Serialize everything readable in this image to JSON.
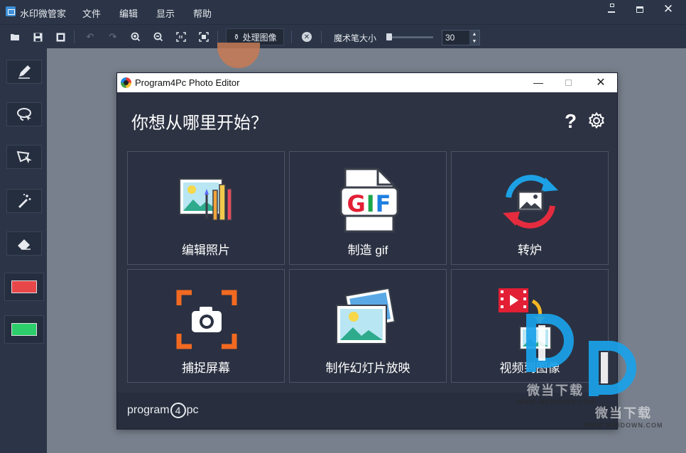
{
  "app": {
    "title": "水印微管家",
    "menu": [
      "文件",
      "编辑",
      "显示",
      "帮助"
    ]
  },
  "window_controls": {
    "minimize": "—",
    "maximize": "□",
    "close": "✕"
  },
  "toolbar": {
    "process_label": "处理图像",
    "brush_size_label": "魔术笔大小",
    "brush_size_value": "30",
    "brush_size_slider_fraction": 0.06
  },
  "sidebar": {
    "tools": [
      "pencil-icon",
      "lasso-icon",
      "polygon-lasso-icon",
      "magic-wand-icon",
      "eraser-icon"
    ],
    "swatch_colors": [
      "#e8474a",
      "#2dcf6c"
    ]
  },
  "dialog": {
    "title": "Program4Pc Photo Editor",
    "heading": "你想从哪里开始？",
    "help_label": "?",
    "cards": [
      {
        "label": "编辑照片"
      },
      {
        "label": "制造 gif"
      },
      {
        "label": "转炉"
      },
      {
        "label": "捕捉屏幕"
      },
      {
        "label": "制作幻灯片放映"
      },
      {
        "label": "视频到图像"
      }
    ],
    "gif_text": "GIF",
    "footer_brand_before": "program",
    "footer_brand_four": "4",
    "footer_brand_after": "pc"
  },
  "watermark": {
    "text": "微当下载",
    "url": "WWW.WEIDOWN.COM"
  }
}
